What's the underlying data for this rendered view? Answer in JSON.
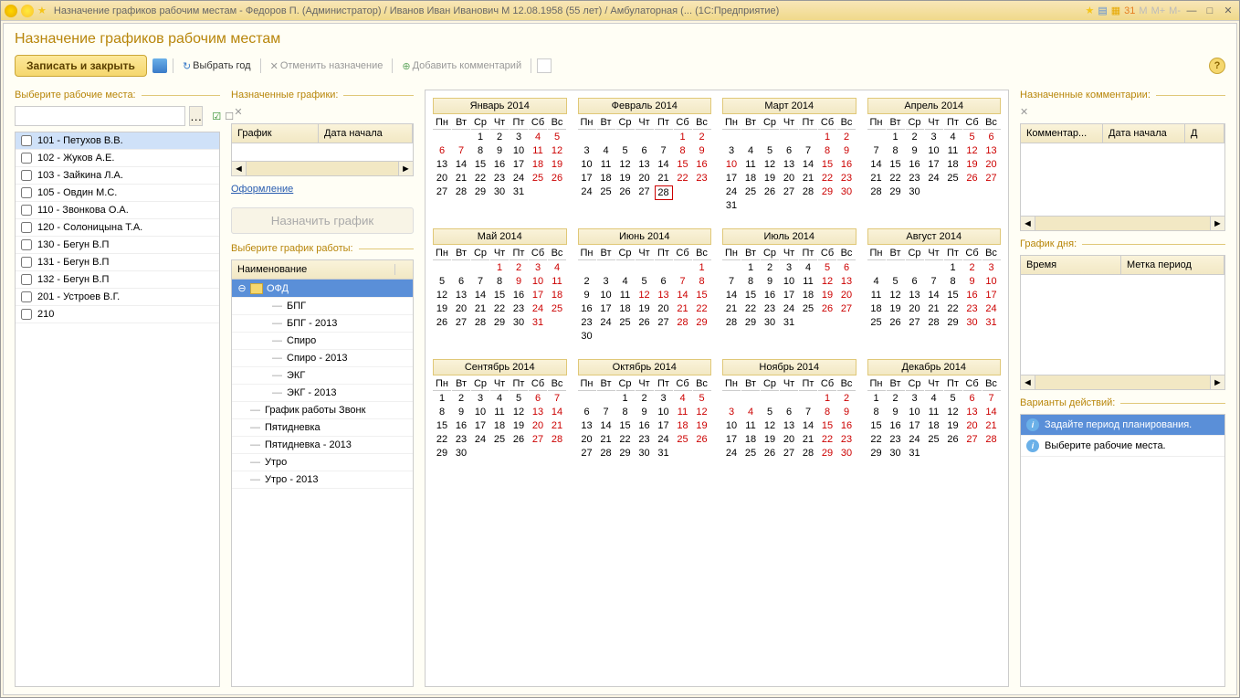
{
  "titlebar": {
    "text": "Назначение графиков рабочим местам - Федоров П. (Администратор) / Иванов Иван Иванович М 12.08.1958 (55 лет) / Амбулаторная (...   (1С:Предприятие)",
    "mem": [
      "M",
      "M+",
      "M-"
    ]
  },
  "page": {
    "title": "Назначение графиков рабочим местам"
  },
  "toolbar": {
    "save_close": "Записать и закрыть",
    "select_year": "Выбрать год",
    "cancel_assign": "Отменить назначение",
    "add_comment": "Добавить комментарий"
  },
  "labels": {
    "select_workplaces": "Выберите рабочие места:",
    "assigned_schedules": "Назначенные графики:",
    "assigned_comments": "Назначенные комментарии:",
    "formatting": "Оформление",
    "assign_schedule": "Назначить график",
    "select_schedule": "Выберите график работы:",
    "day_schedule": "График дня:",
    "action_variants": "Варианты действий:"
  },
  "workplaces": [
    "101 - Петухов В.В.",
    "102 - Жуков А.Е.",
    "103 - Зайкина Л.А.",
    "105 - Овдин М.С.",
    "110 - Звонкова О.А.",
    "120 - Солоницына Т.А.",
    "130 - Бегун В.П",
    "131 - Бегун В.П",
    "132 - Бегун В.П",
    "201 - Устроев В.Г.",
    "210"
  ],
  "sched_table": {
    "col1": "График",
    "col2": "Дата начала"
  },
  "comment_table": {
    "col1": "Комментар...",
    "col2": "Дата начала",
    "col3": "Д"
  },
  "day_table": {
    "col1": "Время",
    "col2": "Метка период"
  },
  "tree": {
    "header": "Наименование",
    "root": "ОФД",
    "items": [
      "БПГ",
      "БПГ - 2013",
      "Спиро",
      "Спиро - 2013",
      "ЭКГ",
      "ЭКГ - 2013"
    ],
    "others": [
      "График работы Звонк",
      "Пятидневка",
      "Пятидневка - 2013",
      "Утро",
      "Утро - 2013"
    ]
  },
  "calendar": {
    "year": 2014,
    "weekdays": [
      "Пн",
      "Вт",
      "Ср",
      "Чт",
      "Пт",
      "Сб",
      "Вс"
    ],
    "months": [
      {
        "name": "Январь 2014",
        "start": 2,
        "days": 31,
        "we": [
          4,
          5,
          6,
          7,
          11,
          12,
          18,
          19,
          25,
          26
        ],
        "today": null
      },
      {
        "name": "Февраль 2014",
        "start": 5,
        "days": 28,
        "we": [
          1,
          2,
          8,
          9,
          15,
          16,
          22,
          23
        ],
        "today": 28
      },
      {
        "name": "Март 2014",
        "start": 5,
        "days": 31,
        "we": [
          1,
          2,
          8,
          9,
          10,
          15,
          16,
          22,
          23,
          29,
          30
        ],
        "today": null
      },
      {
        "name": "Апрель 2014",
        "start": 1,
        "days": 30,
        "we": [
          5,
          6,
          12,
          13,
          19,
          20,
          26,
          27
        ],
        "today": null
      },
      {
        "name": "Май 2014",
        "start": 3,
        "days": 31,
        "we": [
          1,
          2,
          3,
          4,
          9,
          10,
          11,
          17,
          18,
          24,
          25,
          31
        ],
        "today": null
      },
      {
        "name": "Июнь 2014",
        "start": 6,
        "days": 30,
        "we": [
          1,
          7,
          8,
          12,
          13,
          14,
          15,
          21,
          22,
          28,
          29
        ],
        "today": null
      },
      {
        "name": "Июль 2014",
        "start": 1,
        "days": 31,
        "we": [
          5,
          6,
          12,
          13,
          19,
          20,
          26,
          27
        ],
        "today": null
      },
      {
        "name": "Август 2014",
        "start": 4,
        "days": 31,
        "we": [
          2,
          3,
          9,
          10,
          16,
          17,
          23,
          24,
          30,
          31
        ],
        "today": null
      },
      {
        "name": "Сентябрь 2014",
        "start": 0,
        "days": 30,
        "we": [
          6,
          7,
          13,
          14,
          20,
          21,
          27,
          28
        ],
        "today": null
      },
      {
        "name": "Октябрь 2014",
        "start": 2,
        "days": 31,
        "we": [
          4,
          5,
          11,
          12,
          18,
          19,
          25,
          26
        ],
        "today": null
      },
      {
        "name": "Ноябрь 2014",
        "start": 5,
        "days": 30,
        "we": [
          1,
          2,
          3,
          4,
          8,
          9,
          15,
          16,
          22,
          23,
          29,
          30
        ],
        "today": null
      },
      {
        "name": "Декабрь 2014",
        "start": 0,
        "days": 31,
        "we": [
          6,
          7,
          13,
          14,
          20,
          21,
          27,
          28
        ],
        "today": null
      }
    ]
  },
  "actions": [
    "Задайте период планирования.",
    "Выберите рабочие места."
  ]
}
